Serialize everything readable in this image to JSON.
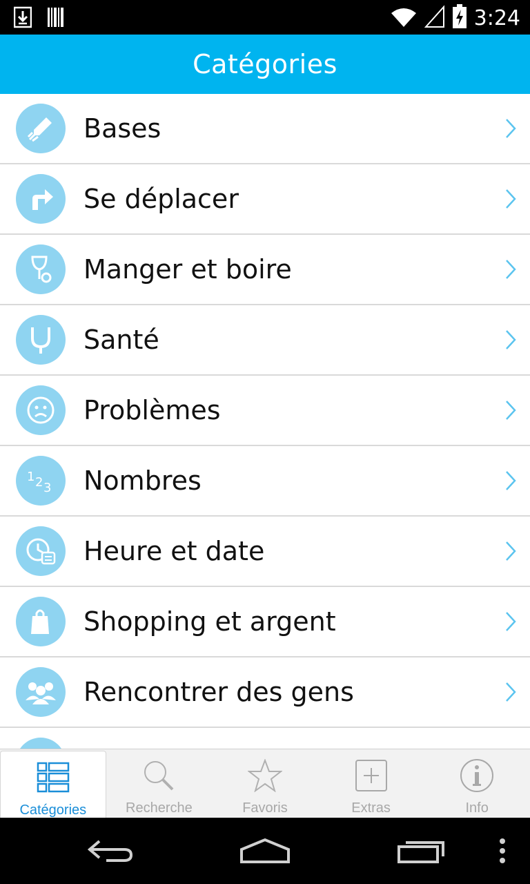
{
  "status_bar": {
    "time": "3:24",
    "icons": [
      "download-icon",
      "barcode-icon",
      "wifi-icon",
      "signal-icon",
      "battery-charging-icon"
    ]
  },
  "app_bar": {
    "title": "Catégories"
  },
  "categories": [
    {
      "label": "Bases",
      "icon": "pencil-icon"
    },
    {
      "label": "Se déplacer",
      "icon": "turn-right-arrow-icon"
    },
    {
      "label": "Manger et boire",
      "icon": "glass-icon"
    },
    {
      "label": "Santé",
      "icon": "stethoscope-icon"
    },
    {
      "label": "Problèmes",
      "icon": "sad-face-icon"
    },
    {
      "label": "Nombres",
      "icon": "numbers-icon"
    },
    {
      "label": "Heure et date",
      "icon": "clock-calendar-icon"
    },
    {
      "label": "Shopping et argent",
      "icon": "shopping-bag-icon"
    },
    {
      "label": "Rencontrer des gens",
      "icon": "people-icon"
    }
  ],
  "tabs": [
    {
      "label": "Catégories",
      "icon": "list-icon",
      "active": true
    },
    {
      "label": "Recherche",
      "icon": "search-icon",
      "active": false
    },
    {
      "label": "Favoris",
      "icon": "star-icon",
      "active": false
    },
    {
      "label": "Extras",
      "icon": "plus-box-icon",
      "active": false
    },
    {
      "label": "Info",
      "icon": "info-icon",
      "active": false
    }
  ],
  "colors": {
    "accent": "#00b4ef",
    "icon_circle": "#8fd4f1",
    "active_tab": "#1a8ed8",
    "chevron": "#5bc4ef"
  },
  "nav_bar": {
    "buttons": [
      "back-icon",
      "home-icon",
      "recents-icon",
      "menu-icon"
    ]
  }
}
